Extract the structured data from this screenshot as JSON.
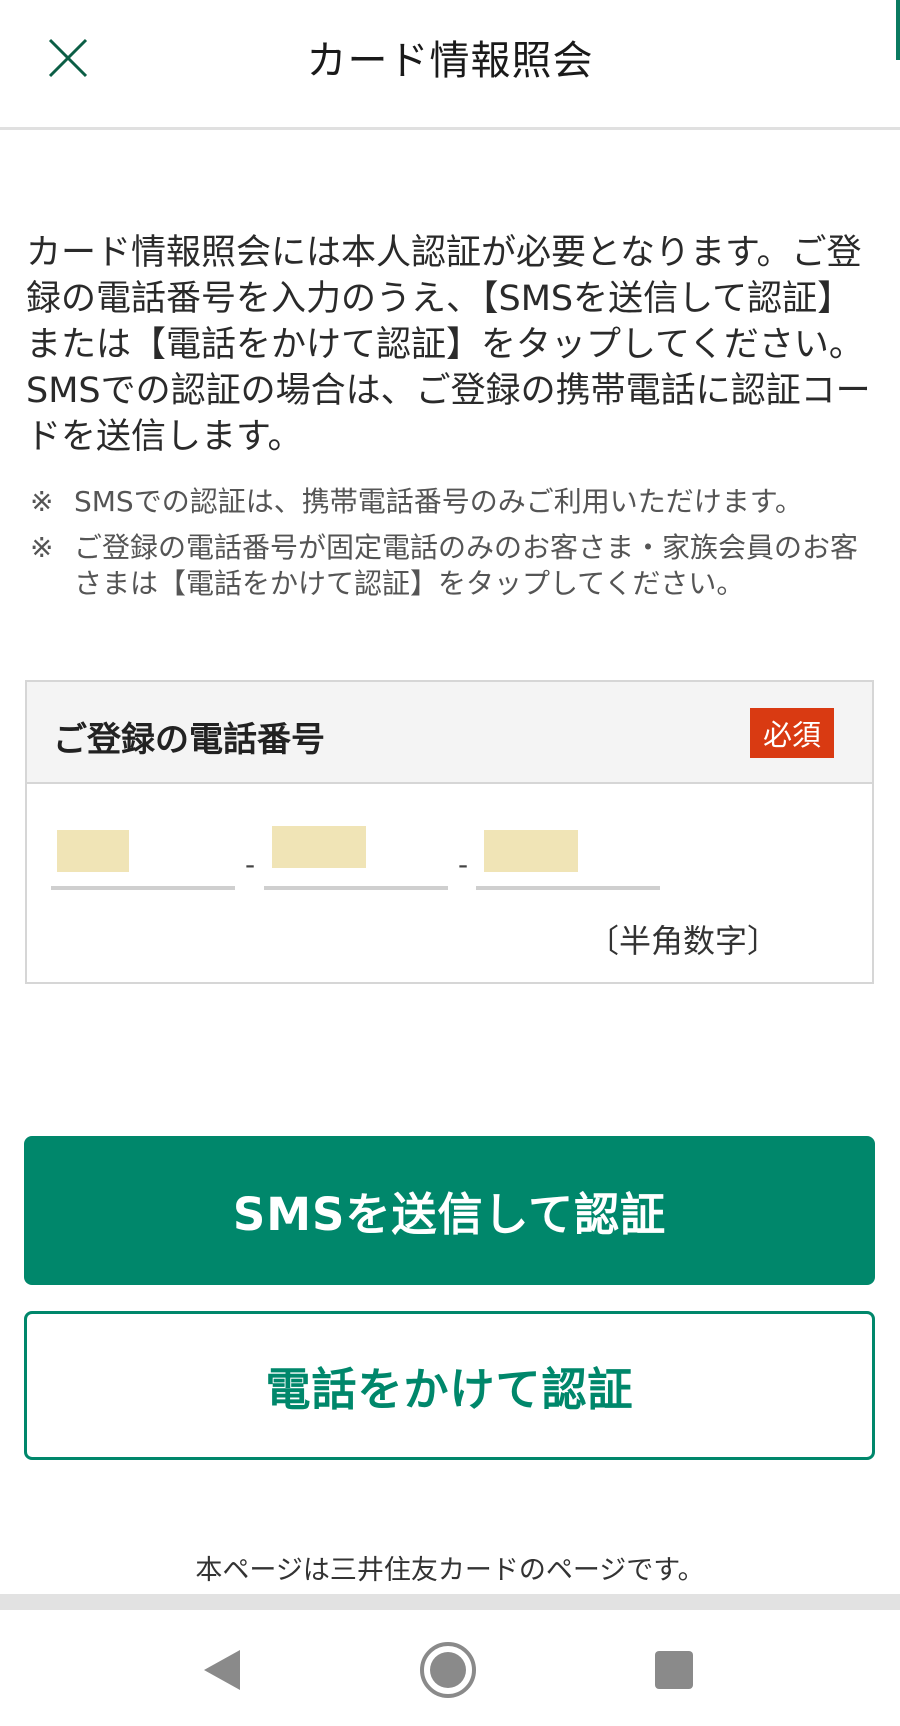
{
  "header": {
    "title": "カード情報照会",
    "close_icon": "close-icon"
  },
  "intro": {
    "paragraph": "カード情報照会には本人認証が必要となります。ご登録の電話番号を入力のうえ、【SMSを送信して認証】または【電話をかけて認証】をタップしてください。SMSでの認証の場合は、ご登録の携帯電話に認証コードを送信します。"
  },
  "notes": [
    {
      "mark": "※",
      "text": "SMSでの認証は、携帯電話番号のみご利用いただけます。"
    },
    {
      "mark": "※",
      "text": "ご登録の電話番号が固定電話のみのお客さま・家族会員のお客さまは【電話をかけて認証】をタップしてください。"
    }
  ],
  "phone_form": {
    "label": "ご登録の電話番号",
    "required_badge": "必須",
    "separator": "-",
    "hint": "〔半角数字〕"
  },
  "buttons": {
    "sms": "SMSを送信して認証",
    "call": "電話をかけて認証"
  },
  "footer": {
    "note": "本ページは三井住友カードのページです。"
  },
  "nav": {
    "back_icon": "back-triangle-icon",
    "home_icon": "home-circle-icon",
    "recents_icon": "recents-square-icon"
  },
  "colors": {
    "accent": "#00876b",
    "required": "#d93a12",
    "masked_fill": "#f0e4b6"
  }
}
